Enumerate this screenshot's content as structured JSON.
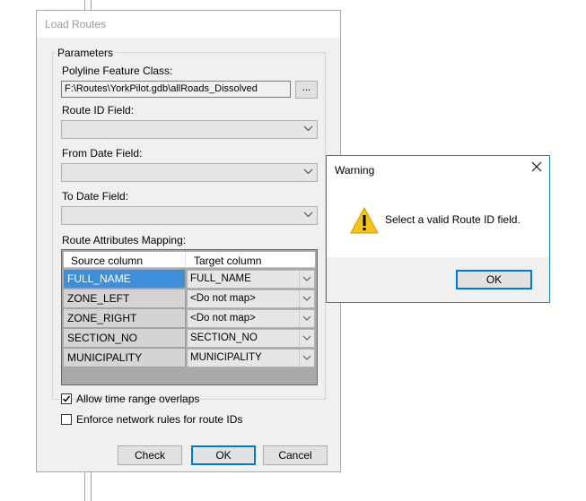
{
  "load_routes": {
    "title": "Load Routes",
    "parameters_legend": "Parameters",
    "polyline_label": "Polyline Feature Class:",
    "polyline_value": "F:\\Routes\\YorkPilot.gdb\\allRoads_Dissolved",
    "browse_label": "...",
    "route_id_label": "Route ID Field:",
    "from_date_label": "From Date Field:",
    "to_date_label": "To Date Field:",
    "mapping_label": "Route Attributes Mapping:",
    "mapping": {
      "headers": [
        "Source column",
        "Target column"
      ],
      "rows": [
        {
          "source": "FULL_NAME",
          "target": "FULL_NAME"
        },
        {
          "source": "ZONE_LEFT",
          "target": "<Do not map>"
        },
        {
          "source": "ZONE_RIGHT",
          "target": "<Do not map>"
        },
        {
          "source": "SECTION_NO",
          "target": "SECTION_NO"
        },
        {
          "source": "MUNICIPALITY",
          "target": "MUNICIPALITY"
        }
      ]
    },
    "allow_overlaps_label": "Allow time range overlaps",
    "allow_overlaps_checked": true,
    "enforce_rules_label": "Enforce network rules for route IDs",
    "enforce_rules_checked": false,
    "buttons": {
      "check": "Check",
      "ok": "OK",
      "cancel": "Cancel"
    }
  },
  "warning": {
    "title": "Warning",
    "message": "Select a valid Route ID field.",
    "ok_label": "OK",
    "icon": "warning-triangle-icon"
  },
  "colors": {
    "selection": "#3d8fd9",
    "accent": "#0078d7",
    "warning_icon": "#f5c518"
  }
}
